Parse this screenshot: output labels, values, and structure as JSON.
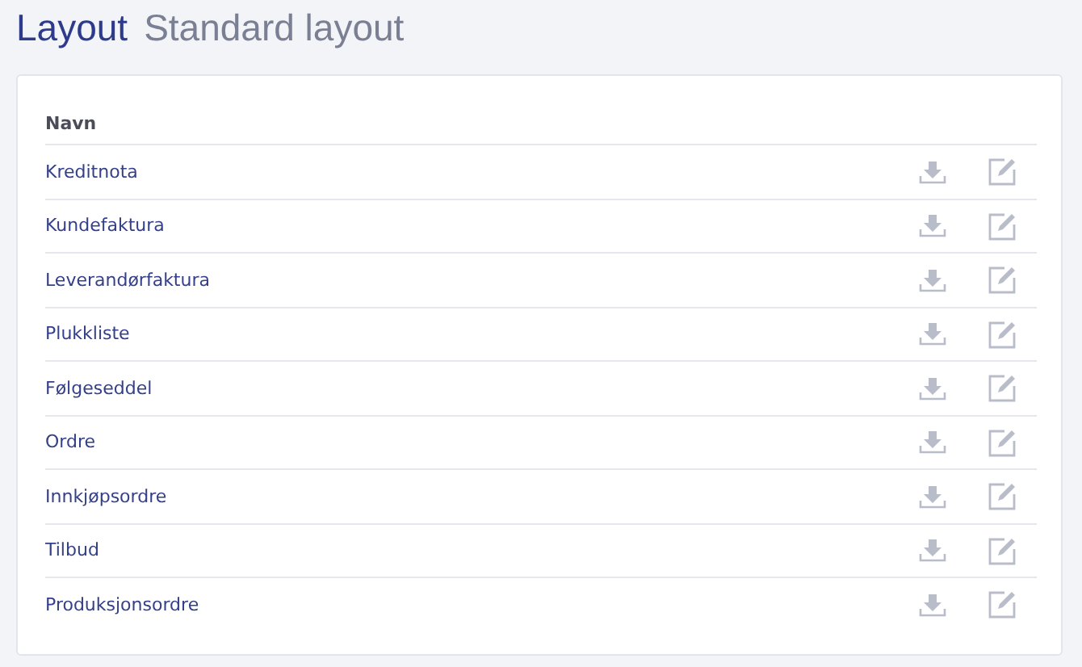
{
  "header": {
    "title": "Layout",
    "subtitle": "Standard layout"
  },
  "table": {
    "columns": [
      "Navn"
    ],
    "rows": [
      {
        "name": "Kreditnota"
      },
      {
        "name": "Kundefaktura"
      },
      {
        "name": "Leverandørfaktura"
      },
      {
        "name": "Plukkliste"
      },
      {
        "name": "Følgeseddel"
      },
      {
        "name": "Ordre"
      },
      {
        "name": "Innkjøpsordre"
      },
      {
        "name": "Tilbud"
      },
      {
        "name": "Produksjonsordre"
      }
    ]
  }
}
